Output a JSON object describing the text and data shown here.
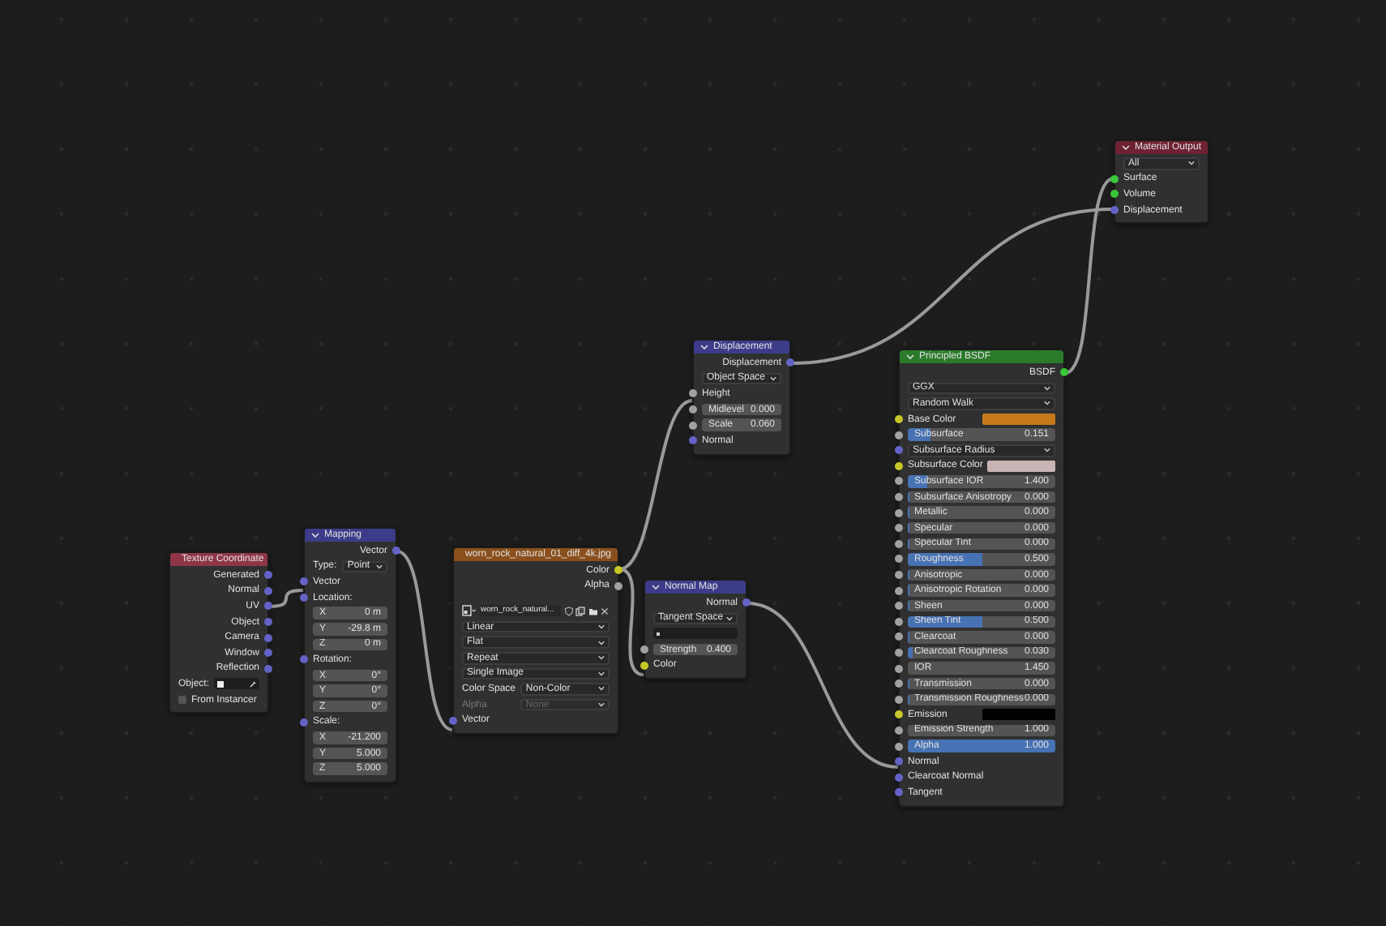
{
  "nodes": [
    {
      "title": "Texture Coordinate",
      "color": "#8e3648",
      "rows": [
        {
          "kind": "out",
          "label": "Generated",
          "socket": {
            "color": "#6363c7"
          }
        },
        {
          "kind": "out",
          "label": "Normal",
          "socket": {
            "color": "#6363c7"
          }
        },
        {
          "kind": "out",
          "label": "UV",
          "socket": {
            "color": "#6363c7"
          }
        },
        {
          "kind": "out",
          "label": "Object",
          "socket": {
            "color": "#6363c7"
          }
        },
        {
          "kind": "out",
          "label": "Camera",
          "socket": {
            "color": "#6363c7"
          }
        },
        {
          "kind": "out",
          "label": "Window",
          "socket": {
            "color": "#6363c7"
          }
        },
        {
          "kind": "out",
          "label": "Reflection",
          "socket": {
            "color": "#6363c7"
          }
        },
        {
          "kind": "object",
          "label": "Object:"
        },
        {
          "kind": "check",
          "label": "From Instancer",
          "checked": false
        }
      ]
    },
    {
      "title": "Mapping",
      "color": "#3c3c8a",
      "rows": [
        {
          "kind": "out",
          "label": "Vector",
          "socket": {
            "color": "#6363c7"
          }
        },
        {
          "kind": "prop",
          "label": "Type:",
          "value": "Point",
          "disabled": false
        },
        {
          "kind": "in",
          "label": "Vector",
          "socket": {
            "color": "#6363c7"
          }
        },
        {
          "kind": "in",
          "label": "Location:",
          "socket": {
            "color": "#6363c7"
          }
        },
        {
          "kind": "number",
          "label": "X",
          "value": "0 m"
        },
        {
          "kind": "number",
          "label": "Y",
          "value": "-29.8 m"
        },
        {
          "kind": "number",
          "label": "Z",
          "value": "0 m"
        },
        {
          "kind": "in",
          "label": "Rotation:",
          "socket": {
            "color": "#6363c7"
          }
        },
        {
          "kind": "number",
          "label": "X",
          "value": "0°"
        },
        {
          "kind": "number",
          "label": "Y",
          "value": "0°"
        },
        {
          "kind": "number",
          "label": "Z",
          "value": "0°"
        },
        {
          "kind": "in",
          "label": "Scale:",
          "socket": {
            "color": "#6363c7"
          }
        },
        {
          "kind": "number",
          "label": "X",
          "value": "-21.200"
        },
        {
          "kind": "number",
          "label": "Y",
          "value": "5.000"
        },
        {
          "kind": "number",
          "label": "Z",
          "value": "5.000"
        }
      ]
    },
    {
      "title": "worn_rock_natural_01_diff_4k.jpg",
      "color": "#8a4f1c",
      "rows": [
        {
          "kind": "out",
          "label": "Color",
          "socket": {
            "color": "#c7c729"
          }
        },
        {
          "kind": "out",
          "label": "Alpha",
          "socket": {
            "color": "#a1a1a1"
          }
        },
        {
          "kind": "image",
          "value": "worn_rock_natural..."
        },
        {
          "kind": "select",
          "value": "Linear"
        },
        {
          "kind": "select",
          "value": "Flat"
        },
        {
          "kind": "select",
          "value": "Repeat"
        },
        {
          "kind": "select",
          "value": "Single Image"
        },
        {
          "kind": "prop",
          "label": "Color Space",
          "value": "Non-Color",
          "disabled": false
        },
        {
          "kind": "prop",
          "label": "Alpha",
          "value": "None",
          "disabled": true
        },
        {
          "kind": "in",
          "label": "Vector",
          "socket": {
            "color": "#6363c7"
          }
        }
      ]
    },
    {
      "title": "Normal Map",
      "color": "#3c3c8a",
      "rows": [
        {
          "kind": "out",
          "label": "Normal",
          "socket": {
            "color": "#6363c7"
          }
        },
        {
          "kind": "select",
          "value": "Tangent Space"
        },
        {
          "kind": "field"
        },
        {
          "kind": "number",
          "label": "Strength",
          "value": "0.400",
          "socket": {
            "color": "#a1a1a1"
          }
        },
        {
          "kind": "in",
          "label": "Color",
          "socket": {
            "color": "#c7c729"
          }
        }
      ]
    },
    {
      "title": "Displacement",
      "color": "#3c3c8a",
      "rows": [
        {
          "kind": "out",
          "label": "Displacement",
          "socket": {
            "color": "#6363c7"
          }
        },
        {
          "kind": "select",
          "value": "Object Space"
        },
        {
          "kind": "in",
          "label": "Height",
          "socket": {
            "color": "#a1a1a1"
          }
        },
        {
          "kind": "number",
          "label": "Midlevel",
          "value": "0.000",
          "socket": {
            "color": "#a1a1a1"
          }
        },
        {
          "kind": "number",
          "label": "Scale",
          "value": "0.060",
          "socket": {
            "color": "#a1a1a1"
          }
        },
        {
          "kind": "in",
          "label": "Normal",
          "socket": {
            "color": "#6363c7"
          }
        }
      ]
    },
    {
      "title": "Principled BSDF",
      "color": "#2a7a2a",
      "rows": [
        {
          "kind": "out",
          "label": "BSDF",
          "socket": {
            "color": "#39c739"
          }
        },
        {
          "kind": "select",
          "value": "GGX"
        },
        {
          "kind": "select",
          "value": "Random Walk"
        },
        {
          "kind": "color",
          "label": "Base Color",
          "color": "#c77a1c",
          "socket": {
            "color": "#c7c729"
          }
        },
        {
          "kind": "slider",
          "label": "Subsurface",
          "value": "0.151",
          "level": 0.151,
          "socket": {
            "color": "#a1a1a1"
          }
        },
        {
          "kind": "select",
          "value": "Subsurface Radius",
          "socket": {
            "color": "#6363c7"
          }
        },
        {
          "kind": "color",
          "label": "Subsurface Color",
          "color": "#c8b4b4",
          "socket": {
            "color": "#c7c729"
          }
        },
        {
          "kind": "slider",
          "label": "Subsurface IOR",
          "value": "1.400",
          "level": 0.13,
          "socket": {
            "color": "#a1a1a1"
          }
        },
        {
          "kind": "slider",
          "label": "Subsurface Anisotropy",
          "value": "0.000",
          "level": 0,
          "socket": {
            "color": "#a1a1a1"
          }
        },
        {
          "kind": "slider",
          "label": "Metallic",
          "value": "0.000",
          "level": 0,
          "socket": {
            "color": "#a1a1a1"
          }
        },
        {
          "kind": "slider",
          "label": "Specular",
          "value": "0.000",
          "level": 0,
          "socket": {
            "color": "#a1a1a1"
          }
        },
        {
          "kind": "slider",
          "label": "Specular Tint",
          "value": "0.000",
          "level": 0,
          "socket": {
            "color": "#a1a1a1"
          }
        },
        {
          "kind": "slider",
          "label": "Roughness",
          "value": "0.500",
          "level": 0.5,
          "socket": {
            "color": "#a1a1a1"
          }
        },
        {
          "kind": "slider",
          "label": "Anisotropic",
          "value": "0.000",
          "level": 0,
          "socket": {
            "color": "#a1a1a1"
          }
        },
        {
          "kind": "slider",
          "label": "Anisotropic Rotation",
          "value": "0.000",
          "level": 0,
          "socket": {
            "color": "#a1a1a1"
          }
        },
        {
          "kind": "slider",
          "label": "Sheen",
          "value": "0.000",
          "level": 0,
          "socket": {
            "color": "#a1a1a1"
          }
        },
        {
          "kind": "slider",
          "label": "Sheen Tint",
          "value": "0.500",
          "level": 0.5,
          "socket": {
            "color": "#a1a1a1"
          }
        },
        {
          "kind": "slider",
          "label": "Clearcoat",
          "value": "0.000",
          "level": 0,
          "socket": {
            "color": "#a1a1a1"
          }
        },
        {
          "kind": "slider",
          "label": "Clearcoat Roughness",
          "value": "0.030",
          "level": 0.03,
          "socket": {
            "color": "#a1a1a1"
          }
        },
        {
          "kind": "number",
          "label": "IOR",
          "value": "1.450",
          "socket": {
            "color": "#a1a1a1"
          }
        },
        {
          "kind": "slider",
          "label": "Transmission",
          "value": "0.000",
          "level": 0,
          "socket": {
            "color": "#a1a1a1"
          }
        },
        {
          "kind": "slider",
          "label": "Transmission Roughness",
          "value": "0.000",
          "level": 0,
          "socket": {
            "color": "#a1a1a1"
          }
        },
        {
          "kind": "color",
          "label": "Emission",
          "color": "#000000",
          "socket": {
            "color": "#c7c729"
          }
        },
        {
          "kind": "number",
          "label": "Emission Strength",
          "value": "1.000",
          "socket": {
            "color": "#a1a1a1"
          }
        },
        {
          "kind": "slider",
          "label": "Alpha",
          "value": "1.000",
          "level": 1,
          "socket": {
            "color": "#a1a1a1"
          }
        },
        {
          "kind": "in",
          "label": "Normal",
          "socket": {
            "color": "#6363c7"
          }
        },
        {
          "kind": "in",
          "label": "Clearcoat Normal",
          "socket": {
            "color": "#6363c7"
          }
        },
        {
          "kind": "in",
          "label": "Tangent",
          "socket": {
            "color": "#6363c7"
          }
        }
      ]
    },
    {
      "title": "Material Output",
      "color": "#6e2233",
      "rows": [
        {
          "kind": "select",
          "value": "All"
        },
        {
          "kind": "in",
          "label": "Surface",
          "socket": {
            "color": "#39c739"
          }
        },
        {
          "kind": "in",
          "label": "Volume",
          "socket": {
            "color": "#39c739"
          }
        },
        {
          "kind": "in",
          "label": "Displacement",
          "socket": {
            "color": "#6363c7"
          }
        }
      ]
    }
  ]
}
